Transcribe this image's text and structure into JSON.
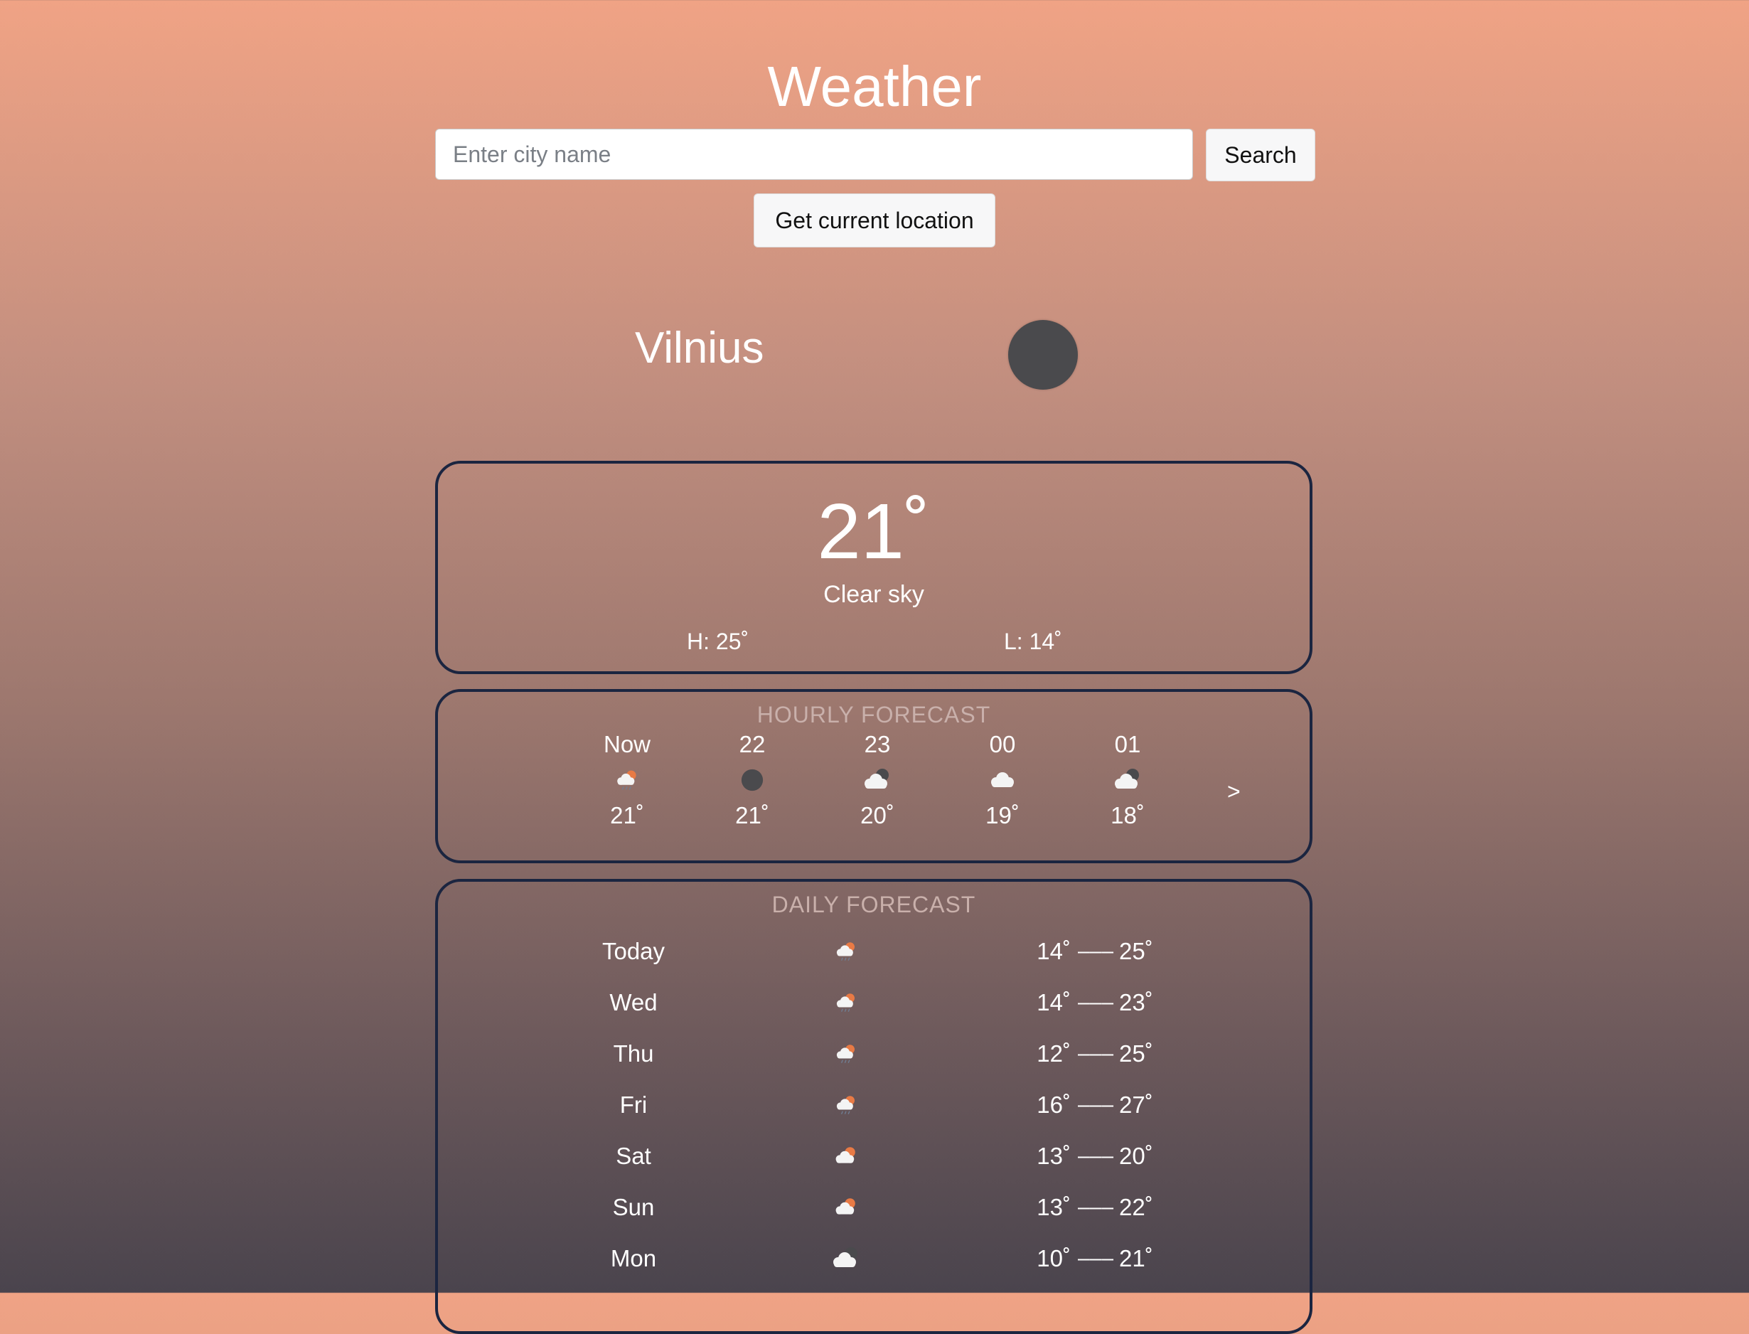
{
  "header": {
    "title": "Weather"
  },
  "search": {
    "placeholder": "Enter city name",
    "value": "",
    "button_label": "Search"
  },
  "location_button_label": "Get current location",
  "city": {
    "name": "Vilnius",
    "icon": "moon-icon"
  },
  "current": {
    "temperature": "21˚",
    "description": "Clear sky",
    "high": "H: 25˚",
    "low": "L: 14˚"
  },
  "hourly": {
    "title": "HOURLY FORECAST",
    "next_label": ">",
    "items": [
      {
        "label": "Now",
        "icon": "rain-sun-icon",
        "temp": "21˚"
      },
      {
        "label": "22",
        "icon": "moon-icon",
        "temp": "21˚"
      },
      {
        "label": "23",
        "icon": "cloud-moon-icon",
        "temp": "20˚"
      },
      {
        "label": "00",
        "icon": "cloud-icon",
        "temp": "19˚"
      },
      {
        "label": "01",
        "icon": "cloud-moon-icon",
        "temp": "18˚"
      }
    ]
  },
  "daily": {
    "title": "DAILY FORECAST",
    "separator": "–––",
    "items": [
      {
        "day": "Today",
        "icon": "rain-sun-icon",
        "low": "14˚",
        "high": "25˚"
      },
      {
        "day": "Wed",
        "icon": "rain-sun-icon",
        "low": "14˚",
        "high": "23˚"
      },
      {
        "day": "Thu",
        "icon": "rain-sun-icon",
        "low": "12˚",
        "high": "25˚"
      },
      {
        "day": "Fri",
        "icon": "rain-sun-icon",
        "low": "16˚",
        "high": "27˚"
      },
      {
        "day": "Sat",
        "icon": "cloud-sun-icon",
        "low": "13˚",
        "high": "20˚"
      },
      {
        "day": "Sun",
        "icon": "cloud-sun-icon",
        "low": "13˚",
        "high": "22˚"
      },
      {
        "day": "Mon",
        "icon": "cloud-moon-icon",
        "low": "10˚",
        "high": "21˚"
      }
    ]
  },
  "colors": {
    "card_border": "#1b2540",
    "moon": "#4a4a4d",
    "sun": "#e87a45",
    "cloud": "#f4f4f4",
    "section_title": "#c9b0ab"
  }
}
